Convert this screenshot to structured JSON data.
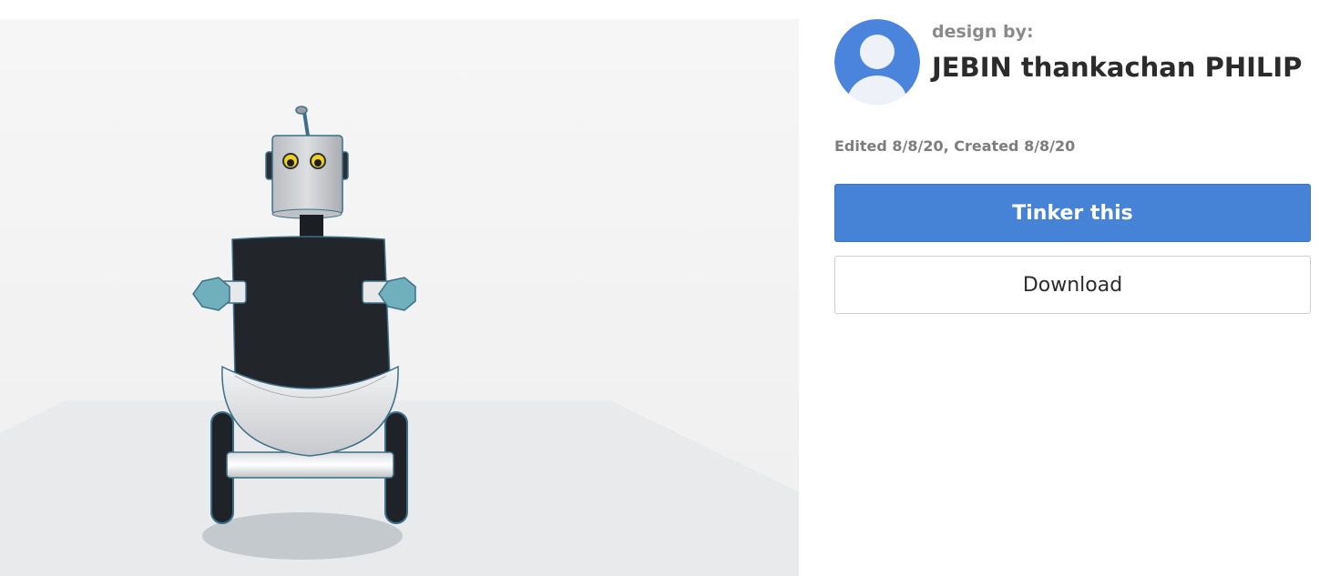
{
  "viewer": {
    "label": "3D design preview",
    "model_colors": {
      "body": "#22262b",
      "head": "#c9cccf",
      "bumper": "#e3e4e6",
      "hands": "#6fb0bc",
      "eyes": "#f0d020",
      "outline": "#3b6f8a"
    }
  },
  "designer": {
    "avatar_icon": "user-avatar-icon",
    "avatar_color": "#4a84dc",
    "design_by_label": "design by:",
    "name": "JEBIN thankachan PHILIP"
  },
  "dates": {
    "text": "Edited 8/8/20, Created 8/8/20"
  },
  "actions": {
    "tinker_label": "Tinker this",
    "download_label": "Download",
    "primary_color": "#4683d6"
  }
}
